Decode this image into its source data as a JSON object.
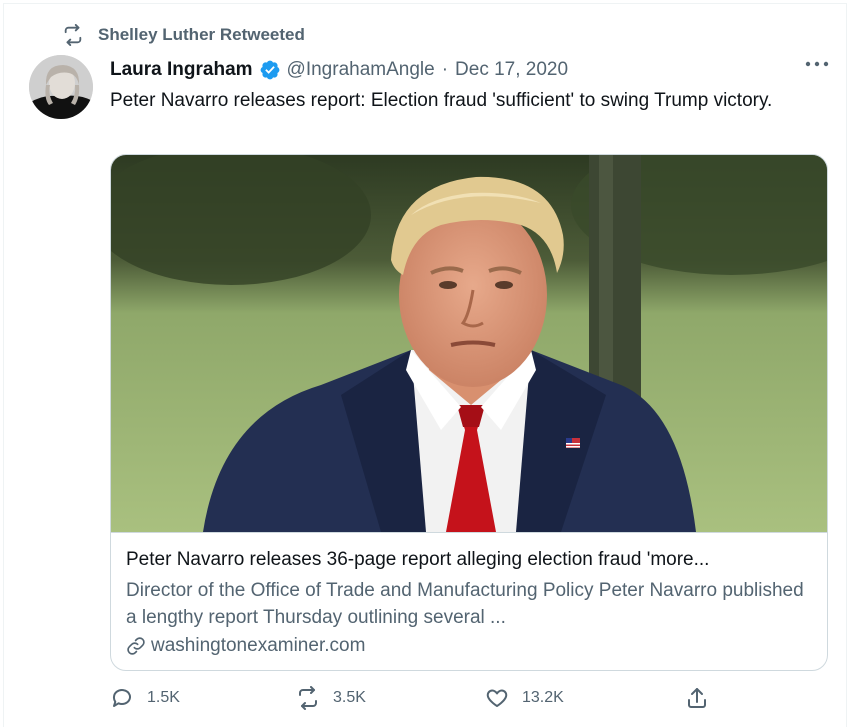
{
  "retweet": {
    "text": "Shelley Luther Retweeted"
  },
  "author": {
    "name": "Laura Ingraham",
    "handle": "@IngrahamAngle",
    "separator": "·",
    "date": "Dec 17, 2020"
  },
  "tweet": {
    "text": "Peter Navarro releases report: Election fraud 'sufficient' to swing Trump victory."
  },
  "card": {
    "title": "Peter Navarro releases 36-page report alleging election fraud 'more...",
    "description": "Director of the Office of Trade and Manufacturing Policy Peter Navarro published a lengthy report Thursday outlining several ...",
    "domain": "washingtonexaminer.com"
  },
  "actions": {
    "replies": "1.5K",
    "retweets": "3.5K",
    "likes": "13.2K"
  },
  "icons": [
    "retweet-icon",
    "verified-badge-icon",
    "more-icon",
    "link-icon",
    "reply-icon",
    "like-icon",
    "share-icon"
  ],
  "colors": {
    "secondary_text": "#536471",
    "verified": "#1d9bf0",
    "border": "#cfd9de"
  }
}
